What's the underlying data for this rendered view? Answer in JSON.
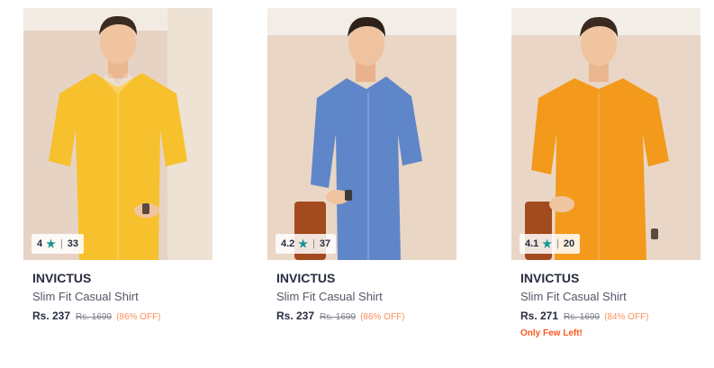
{
  "products": [
    {
      "rating": "4",
      "rating_count": "33",
      "brand": "INVICTUS",
      "name": "Slim Fit Casual Shirt",
      "price": "Rs. 237",
      "mrp": "Rs. 1699",
      "discount": "(86% OFF)",
      "shirt_color": "#f7c12e",
      "stock_note": ""
    },
    {
      "rating": "4.2",
      "rating_count": "37",
      "brand": "INVICTUS",
      "name": "Slim Fit Casual Shirt",
      "price": "Rs. 237",
      "mrp": "Rs. 1699",
      "discount": "(86% OFF)",
      "shirt_color": "#5f86c8",
      "stock_note": ""
    },
    {
      "rating": "4.1",
      "rating_count": "20",
      "brand": "INVICTUS",
      "name": "Slim Fit Casual Shirt",
      "price": "Rs. 271",
      "mrp": "Rs. 1699",
      "discount": "(84% OFF)",
      "shirt_color": "#f39a1c",
      "stock_note": "Only Few Left!"
    }
  ],
  "icons": {
    "rating": "star-icon"
  },
  "colors": {
    "rating_star": "#14958f",
    "discount": "#ff905a",
    "stock_note": "#ff5722"
  }
}
